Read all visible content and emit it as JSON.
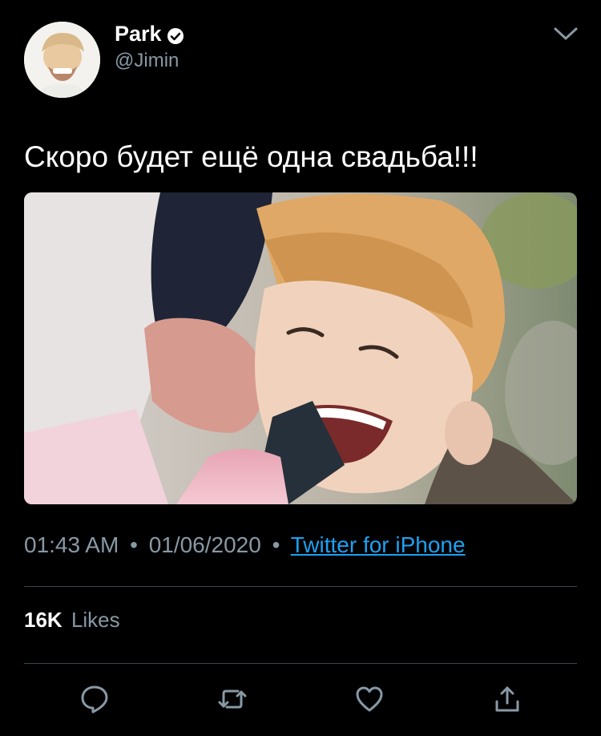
{
  "user": {
    "display_name": "Park",
    "handle": "@Jimin",
    "verified": true
  },
  "tweet": {
    "text": "Скоро будет ещё одна свадьба!!!",
    "time": "01:43 AM",
    "date": "01/06/2020",
    "source": "Twitter for iPhone",
    "separator": "•"
  },
  "stats": {
    "likes_count": "16K",
    "likes_label": "Likes"
  },
  "actions": [
    {
      "icon": "reply-icon"
    },
    {
      "icon": "retweet-icon"
    },
    {
      "icon": "like-icon"
    },
    {
      "icon": "share-icon"
    }
  ],
  "colors": {
    "background": "#000000",
    "text": "#ffffff",
    "secondary_text": "#8899a6",
    "link": "#1da1f2",
    "divider": "#38444d"
  }
}
